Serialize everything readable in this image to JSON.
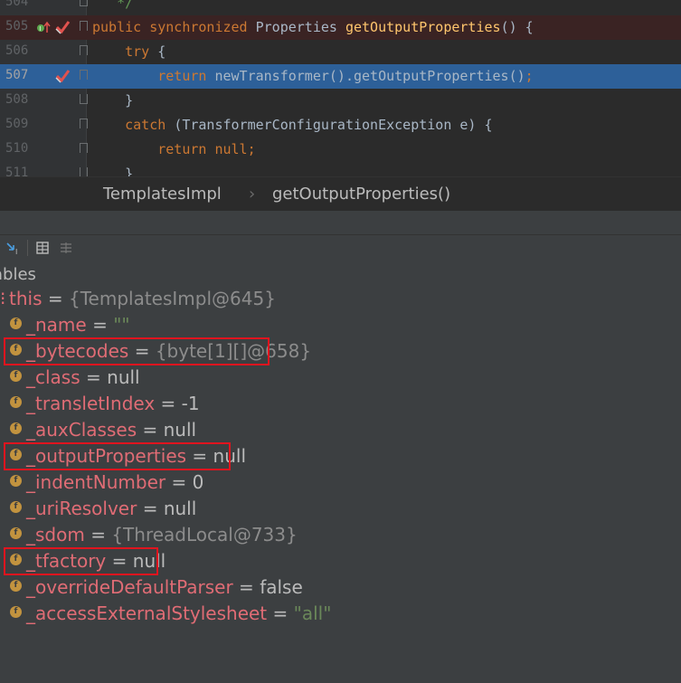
{
  "editor": {
    "lines": [
      {
        "num": "504",
        "kind": "plain",
        "html_parts": [
          {
            "t": "   */",
            "c": "cm"
          }
        ]
      },
      {
        "num": "505",
        "kind": "bp",
        "html_parts": [
          {
            "t": "public synchronized ",
            "c": "kw"
          },
          {
            "t": "Properties ",
            "c": ""
          },
          {
            "t": "getOutputProperties",
            "c": "mth"
          },
          {
            "t": "() {",
            "c": ""
          }
        ]
      },
      {
        "num": "506",
        "kind": "plain",
        "html_parts": [
          {
            "t": "    try ",
            "c": "kw"
          },
          {
            "t": "{",
            "c": ""
          }
        ]
      },
      {
        "num": "507",
        "kind": "exec",
        "html_parts": [
          {
            "t": "        return ",
            "c": "kw"
          },
          {
            "t": "newTransformer().getOutputProperties()",
            "c": ""
          },
          {
            "t": ";",
            "c": "kw"
          }
        ]
      },
      {
        "num": "508",
        "kind": "plain",
        "html_parts": [
          {
            "t": "    }",
            "c": ""
          }
        ]
      },
      {
        "num": "509",
        "kind": "plain",
        "html_parts": [
          {
            "t": "    catch ",
            "c": "kw"
          },
          {
            "t": "(TransformerConfigurationException e) {",
            "c": ""
          }
        ]
      },
      {
        "num": "510",
        "kind": "plain",
        "html_parts": [
          {
            "t": "        return null",
            "c": "kw"
          },
          {
            "t": ";",
            "c": "kw"
          }
        ]
      },
      {
        "num": "511",
        "kind": "plain",
        "html_parts": [
          {
            "t": "    }",
            "c": ""
          }
        ]
      }
    ]
  },
  "breadcrumbs": {
    "class_name": "TemplatesImpl",
    "separator": "›",
    "method_name": "getOutputProperties()"
  },
  "variables": {
    "title": "ables",
    "root": {
      "name": "this",
      "eq": " = ",
      "value": "{TemplatesImpl@645}"
    },
    "fields": [
      {
        "name": "_name",
        "value": "\"\"",
        "vtype": "str",
        "highlight": false
      },
      {
        "name": "_bytecodes",
        "value": "{byte[1][]@658}",
        "vtype": "obj",
        "highlight": true
      },
      {
        "name": "_class",
        "value": "null",
        "vtype": "plain",
        "highlight": false
      },
      {
        "name": "_transletIndex",
        "value": "-1",
        "vtype": "plain",
        "highlight": false
      },
      {
        "name": "_auxClasses",
        "value": "null",
        "vtype": "plain",
        "highlight": false
      },
      {
        "name": "_outputProperties",
        "value": "null",
        "vtype": "plain",
        "highlight": true
      },
      {
        "name": "_indentNumber",
        "value": "0",
        "vtype": "plain",
        "highlight": false
      },
      {
        "name": "_uriResolver",
        "value": "null",
        "vtype": "plain",
        "highlight": false
      },
      {
        "name": "_sdom",
        "value": "{ThreadLocal@733}",
        "vtype": "obj",
        "highlight": false
      },
      {
        "name": "_tfactory",
        "value": "null",
        "vtype": "plain",
        "highlight": true
      },
      {
        "name": "_overrideDefaultParser",
        "value": "false",
        "vtype": "plain",
        "highlight": false
      },
      {
        "name": "_accessExternalStylesheet",
        "value": "\"all\"",
        "vtype": "str",
        "highlight": false
      }
    ],
    "field_badge": "f",
    "eq": " = "
  },
  "colors": {
    "highlight_box": "#e0141e",
    "exec_line": "#2d6099",
    "breakpoint": "#e0524e"
  },
  "icons": {
    "breakpoint": "breakpoint-check-icon",
    "method_up": "method-override-icon",
    "toolbar": [
      "step-into-icon",
      "table-view-icon",
      "list-view-icon"
    ]
  }
}
